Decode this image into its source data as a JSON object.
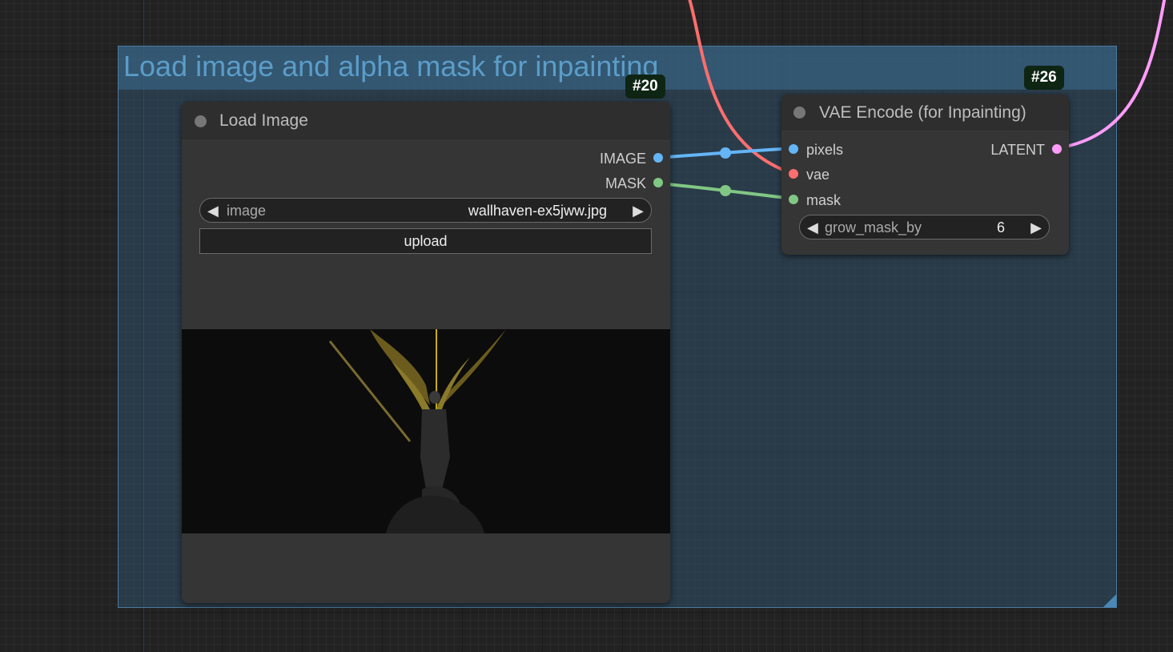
{
  "group": {
    "title": "Load image and alpha mask for inpainting"
  },
  "load_image_node": {
    "badge": "#20",
    "title": "Load Image",
    "outputs": [
      "IMAGE",
      "MASK"
    ],
    "image_widget": {
      "label": "image",
      "value": "wallhaven-ex5jww.jpg"
    },
    "upload_label": "upload"
  },
  "vae_node": {
    "badge": "#26",
    "title": "VAE Encode (for Inpainting)",
    "inputs": [
      "pixels",
      "vae",
      "mask"
    ],
    "output": "LATENT",
    "grow_widget": {
      "label": "grow_mask_by",
      "value": "6"
    }
  },
  "colors": {
    "image_link": "#64b5f6",
    "vae_link": "#ff6e6e",
    "mask_link": "#81c784",
    "latent_link": "#ff9cf9",
    "accent_yellow": "#c8b000"
  },
  "icons": [
    "arrow-left-icon",
    "arrow-right-icon",
    "status-dot-icon"
  ]
}
